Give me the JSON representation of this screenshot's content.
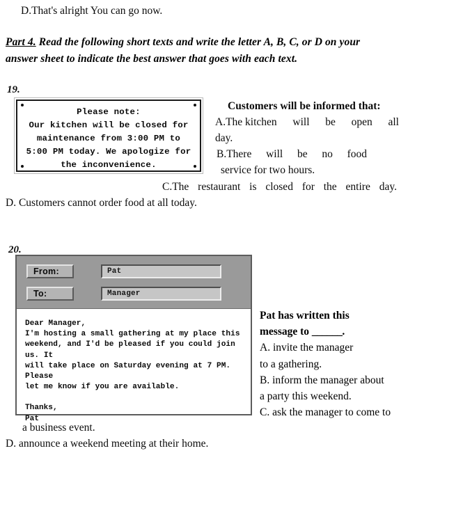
{
  "page": {
    "previous_line": "D.That's alright You can go now.",
    "part_label": "Part 4.",
    "part_instruction": " Read the following short texts and write the letter A, B, C, or D on your answer sheet to indicate the best answer that goes with each text."
  },
  "question19": {
    "number": "19.",
    "notice": {
      "line1": "Please note:",
      "line2": "Our kitchen will be closed for",
      "line3": "maintenance from 3:00 PM to",
      "line4": "5:00 PM today. We apologize for",
      "line5": "the inconvenience."
    },
    "stem": "Customers will be informed that:",
    "options": {
      "a_words": [
        "A.The kitchen",
        "will",
        "be",
        "open",
        "all"
      ],
      "a_cont": "day.",
      "b_words": [
        "B.There",
        "will",
        "be",
        "no",
        "food"
      ],
      "b_cont": "service for two  hours.",
      "c_words": [
        "C.The",
        "restaurant",
        "is",
        "closed",
        "for",
        "the",
        "entire",
        "day."
      ],
      "d": "D. Customers cannot order food at all today."
    }
  },
  "question20": {
    "number": "20.",
    "email": {
      "from_label": "From:",
      "from_value": "Pat",
      "to_label": "To:",
      "to_value": "Manager",
      "body": "Dear Manager,\nI'm hosting a small gathering at my place this\nweekend, and I'd be pleased if you could join us. It\nwill take place on Saturday evening at 7 PM. Please\nlet me know if you are available.",
      "signoff": "Thanks,\nPat"
    },
    "stem_line1": "Pat has written this",
    "stem_line2_pre": "message to ",
    "stem_blank": "______",
    "stem_line2_post": ".",
    "options": {
      "a_line1": "A. invite the manager",
      "a_line2": "to a gathering.",
      "b_line1": "B. inform the manager about",
      "b_line2": "a party this weekend.",
      "c_line1": "C. ask the manager to come to",
      "c_line2": "a business event.",
      "d": "D. announce a weekend meeting at their home."
    }
  },
  "colors": {
    "text": "#0b0b0b",
    "sign_border": "#1a1a1a",
    "email_chrome": "#9a9a9a",
    "email_border": "#5c5c5c",
    "field_face": "#b4b4b4",
    "field_input": "#c6c6c6"
  }
}
